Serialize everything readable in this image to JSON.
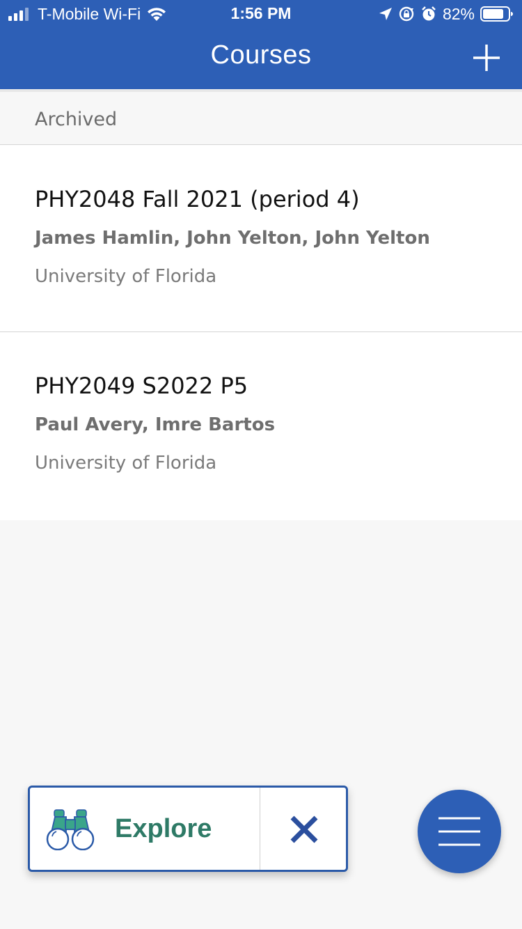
{
  "status_bar": {
    "carrier": "T-Mobile Wi-Fi",
    "time": "1:56 PM",
    "battery_percent": "82%",
    "battery_level": 0.82,
    "icons": [
      "signal-bars-icon",
      "wifi-icon",
      "location-arrow-icon",
      "rotation-lock-icon",
      "alarm-icon",
      "battery-icon"
    ]
  },
  "nav": {
    "title": "Courses",
    "add_icon": "plus-icon"
  },
  "section": {
    "label": "Archived"
  },
  "courses": [
    {
      "title": "PHY2048 Fall 2021 (period 4)",
      "instructors": "James Hamlin, John Yelton, John Yelton",
      "school": "University of Florida"
    },
    {
      "title": "PHY2049 S2022 P5",
      "instructors": "Paul Avery, Imre Bartos",
      "school": "University of Florida"
    }
  ],
  "explore_banner": {
    "label": "Explore",
    "icon": "binoculars-icon",
    "close_icon": "close-icon"
  },
  "menu_fab": {
    "icon": "hamburger-menu-icon"
  },
  "colors": {
    "primary": "#2d5fb6",
    "explore_text": "#2e7a66",
    "background": "#f7f7f7"
  }
}
